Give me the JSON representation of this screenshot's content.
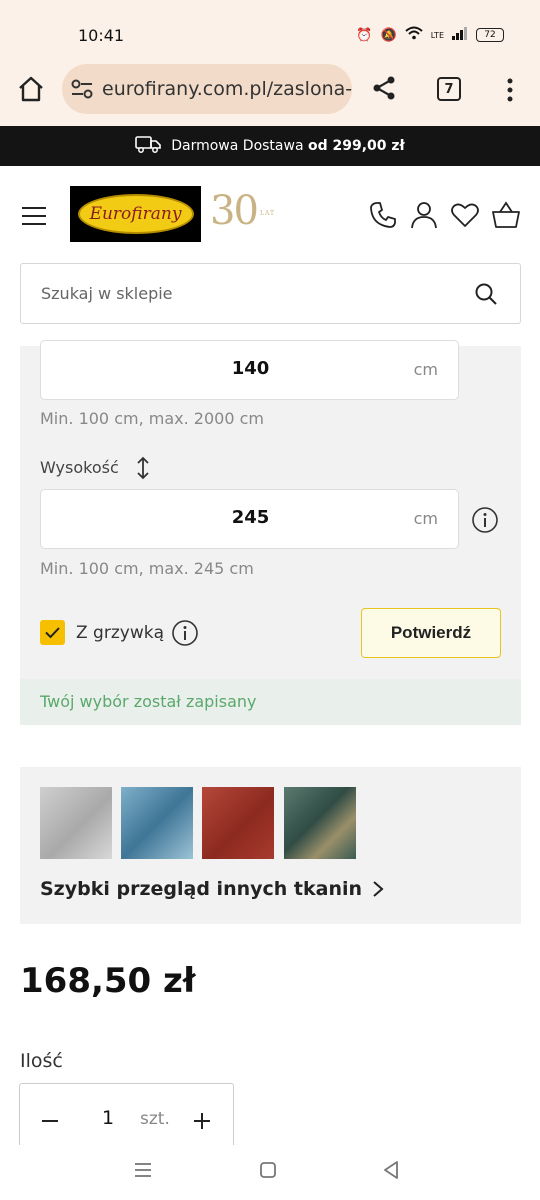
{
  "status_bar": {
    "time": "10:41",
    "battery": "72",
    "network": "LTE"
  },
  "browser": {
    "url": "eurofirany.com.pl/zaslona-",
    "tab_count": "7"
  },
  "promo": {
    "text": "Darmowa Dostawa",
    "highlight": "od 299,00 zł"
  },
  "header": {
    "logo_text": "Eurofirany",
    "anniversary": "30",
    "anniversary_suffix": "LAT",
    "search_placeholder": "Szukaj w sklepie"
  },
  "configurator": {
    "width_value": "140",
    "width_unit": "cm",
    "width_hint": "Min. 100 cm, max. 2000 cm",
    "height_label": "Wysokość",
    "height_value": "245",
    "height_unit": "cm",
    "height_hint": "Min. 100 cm, max. 245 cm",
    "fringe_label": "Z grzywką",
    "fringe_checked": true,
    "confirm_label": "Potwierdź",
    "saved_message": "Twój wybór został zapisany"
  },
  "fabrics": {
    "title": "Szybki przegląd innych tkanin",
    "swatches": [
      {
        "name": "grey",
        "color": "#bdbdbd"
      },
      {
        "name": "blue",
        "color": "#4f86a6"
      },
      {
        "name": "red",
        "color": "#a23a2c"
      },
      {
        "name": "teal-gold",
        "color": "#3c5a52"
      }
    ]
  },
  "product": {
    "price": "168,50 zł",
    "qty_label": "Ilość",
    "qty_value": "1",
    "qty_unit": "szt."
  },
  "colors": {
    "accent": "#f6c000",
    "promo_bg": "#141414",
    "success_text": "#5aa86a",
    "browser_bg": "#fbf1e9"
  }
}
